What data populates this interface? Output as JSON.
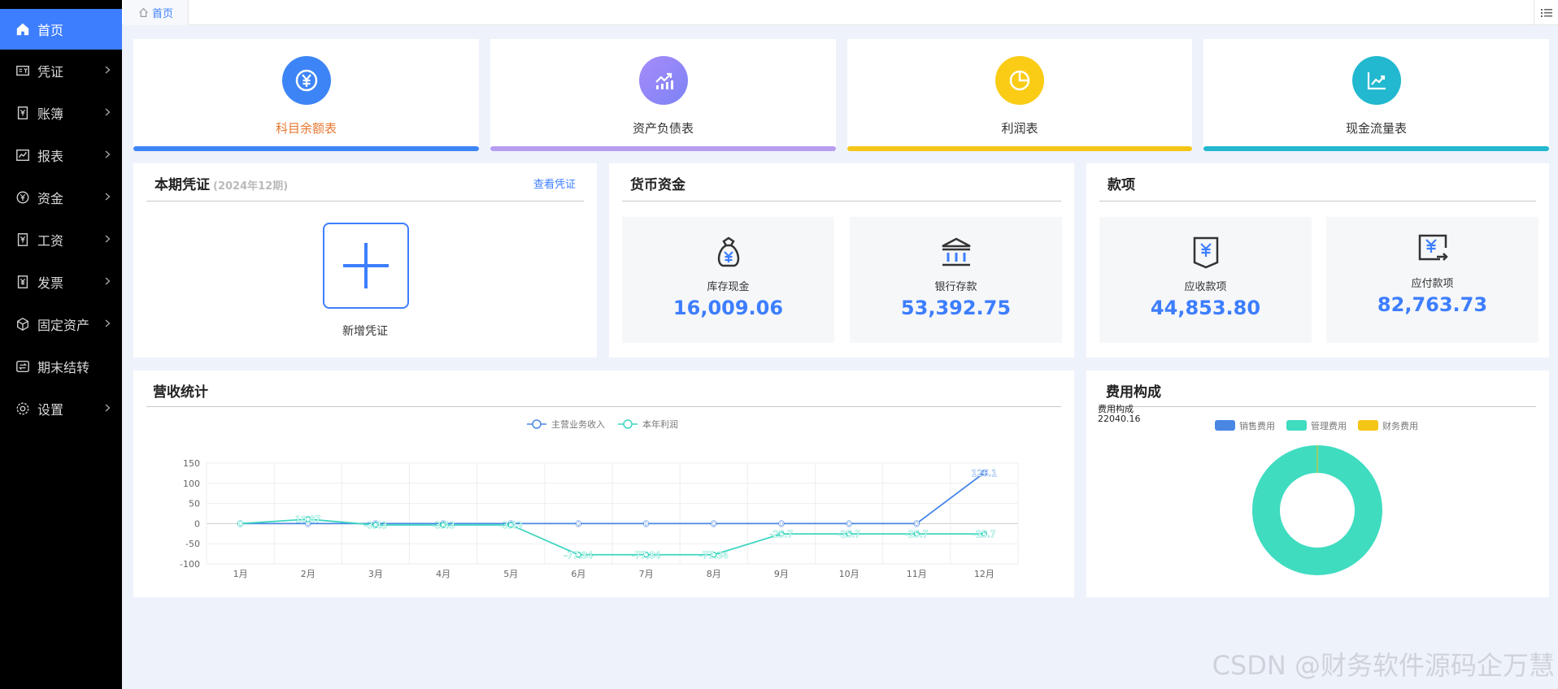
{
  "sidebar": {
    "items": [
      {
        "label": "首页",
        "icon": "home-icon",
        "active": true,
        "arrow": false
      },
      {
        "label": "凭证",
        "icon": "voucher-icon",
        "arrow": true
      },
      {
        "label": "账簿",
        "icon": "ledger-icon",
        "arrow": true
      },
      {
        "label": "报表",
        "icon": "report-icon",
        "arrow": true
      },
      {
        "label": "资金",
        "icon": "fund-icon",
        "arrow": true
      },
      {
        "label": "工资",
        "icon": "salary-icon",
        "arrow": true
      },
      {
        "label": "发票",
        "icon": "invoice-icon",
        "arrow": true
      },
      {
        "label": "固定资产",
        "icon": "asset-icon",
        "arrow": true
      },
      {
        "label": "期末结转",
        "icon": "transfer-icon",
        "arrow": false
      },
      {
        "label": "设置",
        "icon": "settings-icon",
        "arrow": true
      }
    ]
  },
  "tabs": [
    {
      "label": "首页"
    }
  ],
  "report_cards": [
    {
      "label": "科目余额表",
      "color": "#3d85f6",
      "label_color": "#e8772e",
      "icon": "yen-icon"
    },
    {
      "label": "资产负债表",
      "color": "#a78bfa",
      "label_color": "#333333",
      "icon": "trend-icon"
    },
    {
      "label": "利润表",
      "color": "#facc15",
      "label_color": "#333333",
      "icon": "pie-icon"
    },
    {
      "label": "现金流量表",
      "color": "#22b8cf",
      "label_color": "#333333",
      "icon": "chart-icon"
    }
  ],
  "voucher": {
    "title": "本期凭证",
    "period": "(2024年12期)",
    "link": "查看凭证",
    "add_label": "新增凭证"
  },
  "cash": {
    "title": "货币资金",
    "items": [
      {
        "label": "库存现金",
        "amount": "16,009.06"
      },
      {
        "label": "银行存款",
        "amount": "53,392.75"
      }
    ]
  },
  "payments": {
    "title": "款项",
    "items": [
      {
        "label": "应收款项",
        "amount": "44,853.80"
      },
      {
        "label": "应付款项",
        "amount": "82,763.73"
      }
    ]
  },
  "revenue": {
    "title": "营收统计"
  },
  "expense": {
    "title": "费用构成",
    "caption": "费用构成",
    "caption_value": "22040.16"
  },
  "watermark": "CSDN @财务软件源码企万慧",
  "chart_data": [
    {
      "type": "line",
      "categories": [
        "1月",
        "2月",
        "3月",
        "4月",
        "5月",
        "6月",
        "7月",
        "8月",
        "9月",
        "10月",
        "11月",
        "12月"
      ],
      "ylim": [
        -100,
        150
      ],
      "yticks": [
        150,
        100,
        50,
        0,
        -50,
        -100
      ],
      "grid": true,
      "legend": "top-center",
      "series": [
        {
          "name": "主营业务收入",
          "color": "#4a87e3",
          "values": [
            0,
            0,
            0,
            0,
            0,
            0,
            0,
            0,
            0,
            0,
            0,
            126.1
          ]
        },
        {
          "name": "本年利润",
          "color": "#3ed6c0",
          "values": [
            0,
            10.87,
            -3.43,
            -3.43,
            -3.43,
            -77.34,
            -77.34,
            -77.34,
            -25.7,
            -25.7,
            -25.7,
            -25.7
          ]
        }
      ]
    },
    {
      "type": "pie",
      "legend": "top-center",
      "series": [
        {
          "name": "销售费用",
          "color": "#4a87e3",
          "value": 0
        },
        {
          "name": "管理费用",
          "color": "#3fdcc0",
          "value": 22040.16
        },
        {
          "name": "财务费用",
          "color": "#f5c518",
          "value": 0
        }
      ]
    }
  ]
}
